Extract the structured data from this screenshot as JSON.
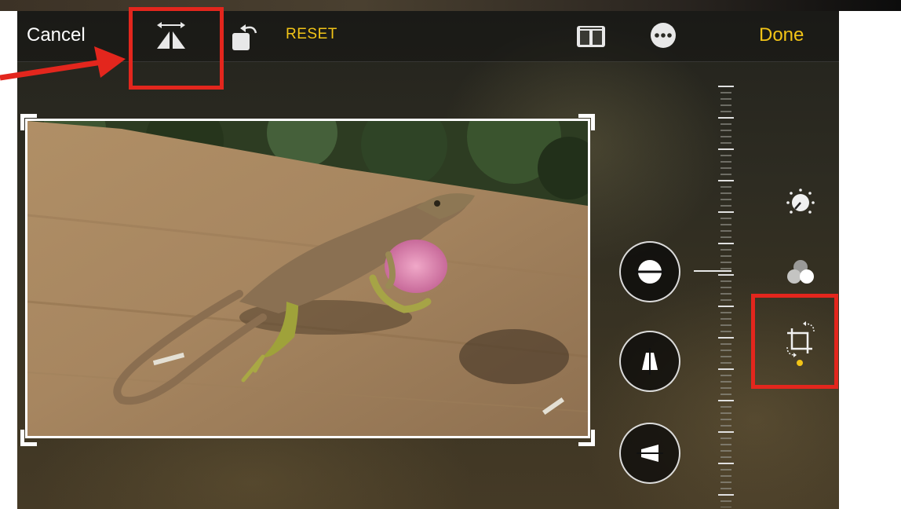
{
  "toolbar": {
    "cancel_label": "Cancel",
    "reset_label": "RESET",
    "done_label": "Done",
    "icons": [
      "flip-horizontal-icon",
      "rotate-icon",
      "aspect-ratio-icon",
      "more-icon"
    ]
  },
  "side_tools": [
    "adjust-icon",
    "filters-icon",
    "crop-icon"
  ],
  "adjust_dials": [
    "straighten-icon",
    "vertical-perspective-icon",
    "horizontal-perspective-icon"
  ],
  "colors": {
    "accent": "#f2c417",
    "annotation": "#e3261d",
    "text": "#ffffff"
  }
}
